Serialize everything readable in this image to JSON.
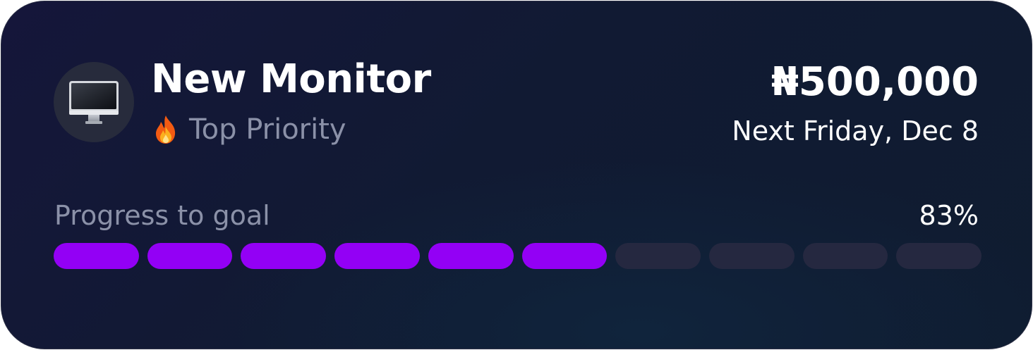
{
  "goal": {
    "icon": "desktop-monitor-icon",
    "title": "New Monitor",
    "priority_icon": "fire-icon",
    "priority": "Top Priority",
    "amount": "₦500,000",
    "due": "Next Friday, Dec 8"
  },
  "progress": {
    "label": "Progress to goal",
    "percent_text": "83%",
    "segments_total": 10,
    "segments_filled": 6,
    "fill_color": "#9300f5",
    "empty_color": "#252840"
  }
}
